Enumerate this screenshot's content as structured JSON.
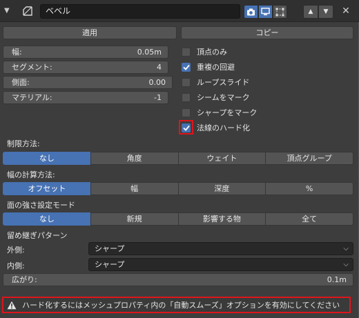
{
  "header": {
    "modifier_name": "ベベル",
    "collapse_icon": "chevron-down-icon",
    "modifier_icon": "bevel-modifier-icon",
    "visibility_buttons": [
      "camera-icon",
      "monitor-icon",
      "edit-mode-icon"
    ],
    "move_buttons": [
      "up-arrow-icon",
      "down-arrow-icon"
    ],
    "close_icon": "close-icon"
  },
  "actions": {
    "apply_label": "適用",
    "copy_label": "コピー"
  },
  "params": {
    "width": {
      "label": "幅:",
      "value": "0.05m"
    },
    "segments": {
      "label": "セグメント:",
      "value": "4"
    },
    "profile": {
      "label": "側面:",
      "value": "0.00"
    },
    "material": {
      "label": "マテリアル:",
      "value": "-1"
    }
  },
  "options": [
    {
      "label": "頂点のみ",
      "checked": false
    },
    {
      "label": "重複の回避",
      "checked": true
    },
    {
      "label": "ループスライド",
      "checked": false
    },
    {
      "label": "シームをマーク",
      "checked": false
    },
    {
      "label": "シャープをマーク",
      "checked": false
    },
    {
      "label": "法線のハード化",
      "checked": true
    }
  ],
  "limit_method": {
    "label": "制限方法:",
    "options": [
      "なし",
      "角度",
      "ウェイト",
      "頂点グループ"
    ],
    "selected": "なし"
  },
  "width_method": {
    "label": "幅の計算方法:",
    "options": [
      "オフセット",
      "幅",
      "深度",
      "%"
    ],
    "selected": "オフセット"
  },
  "face_strength": {
    "label": "面の強さ設定モード",
    "options": [
      "なし",
      "新規",
      "影響する物",
      "全て"
    ],
    "selected": "なし"
  },
  "miter": {
    "label": "留め継ぎパターン",
    "outer_label": "外側:",
    "outer_value": "シャープ",
    "inner_label": "内側:",
    "inner_value": "シャープ"
  },
  "spread": {
    "label": "広がり:",
    "value": "0.1m"
  },
  "warning": {
    "icon": "warning-icon",
    "text": "ハード化するにはメッシュプロパティ内の「自動スムーズ」オプションを有効にしてください"
  },
  "colors": {
    "accent": "#4772b3",
    "highlight": "#e0141b"
  }
}
